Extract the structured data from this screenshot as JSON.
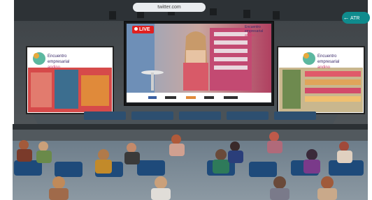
{
  "browser": {
    "url": "twitter.com"
  },
  "nav": {
    "button_label": "ATR"
  },
  "stream": {
    "live_label": "LIVE"
  },
  "event": {
    "logo_line1": "Encuentro",
    "logo_line2": "empresarial",
    "logo_line3": "andino"
  },
  "colors": {
    "accent": "#0f8b8d",
    "live": "#e02020"
  }
}
